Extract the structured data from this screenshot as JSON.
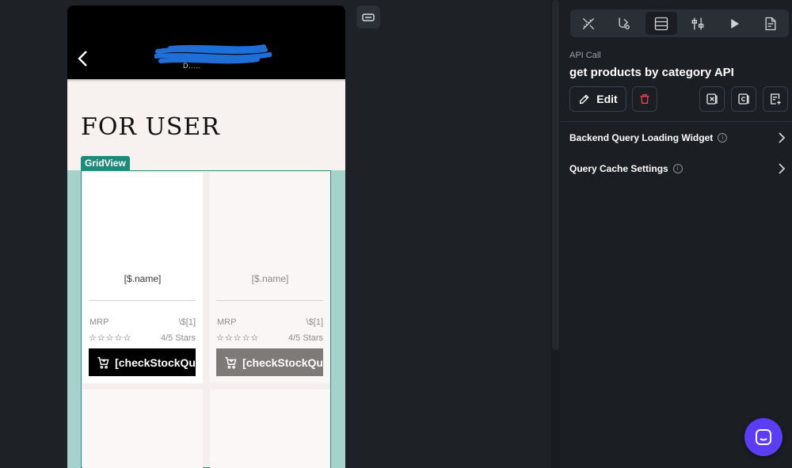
{
  "canvas": {
    "app_bar": {
      "subtitle": "D....."
    },
    "page_title": "FOR USER",
    "grid_badge": "GridView",
    "cards": [
      {
        "name": "[$.name]",
        "mrp_label": "MRP",
        "price": "\\$[1]",
        "stars": "☆☆☆☆☆",
        "stars_text": "4/5 Stars",
        "button_label": "[checkStockQu"
      },
      {
        "name": "[$.name]",
        "mrp_label": "MRP",
        "price": "\\$[1]",
        "stars": "☆☆☆☆☆",
        "stars_text": "4/5 Stars",
        "button_label": "[checkStockQu"
      }
    ]
  },
  "panel": {
    "tabs": [
      {
        "icon": "design-icon"
      },
      {
        "icon": "actions-icon"
      },
      {
        "icon": "backend-query-icon",
        "active": true
      },
      {
        "icon": "properties-icon"
      },
      {
        "icon": "play-icon"
      },
      {
        "icon": "notes-icon"
      }
    ],
    "section_label": "API Call",
    "section_title": "get products by category API",
    "edit_label": "Edit",
    "rows": [
      {
        "label": "Backend Query Loading Widget"
      },
      {
        "label": "Query Cache Settings"
      }
    ]
  },
  "colors": {
    "accent": "#1d8b79",
    "grid_bg": "#a6d2cc",
    "chat_button": "#5b3df5",
    "delete_icon": "#e5484d"
  }
}
